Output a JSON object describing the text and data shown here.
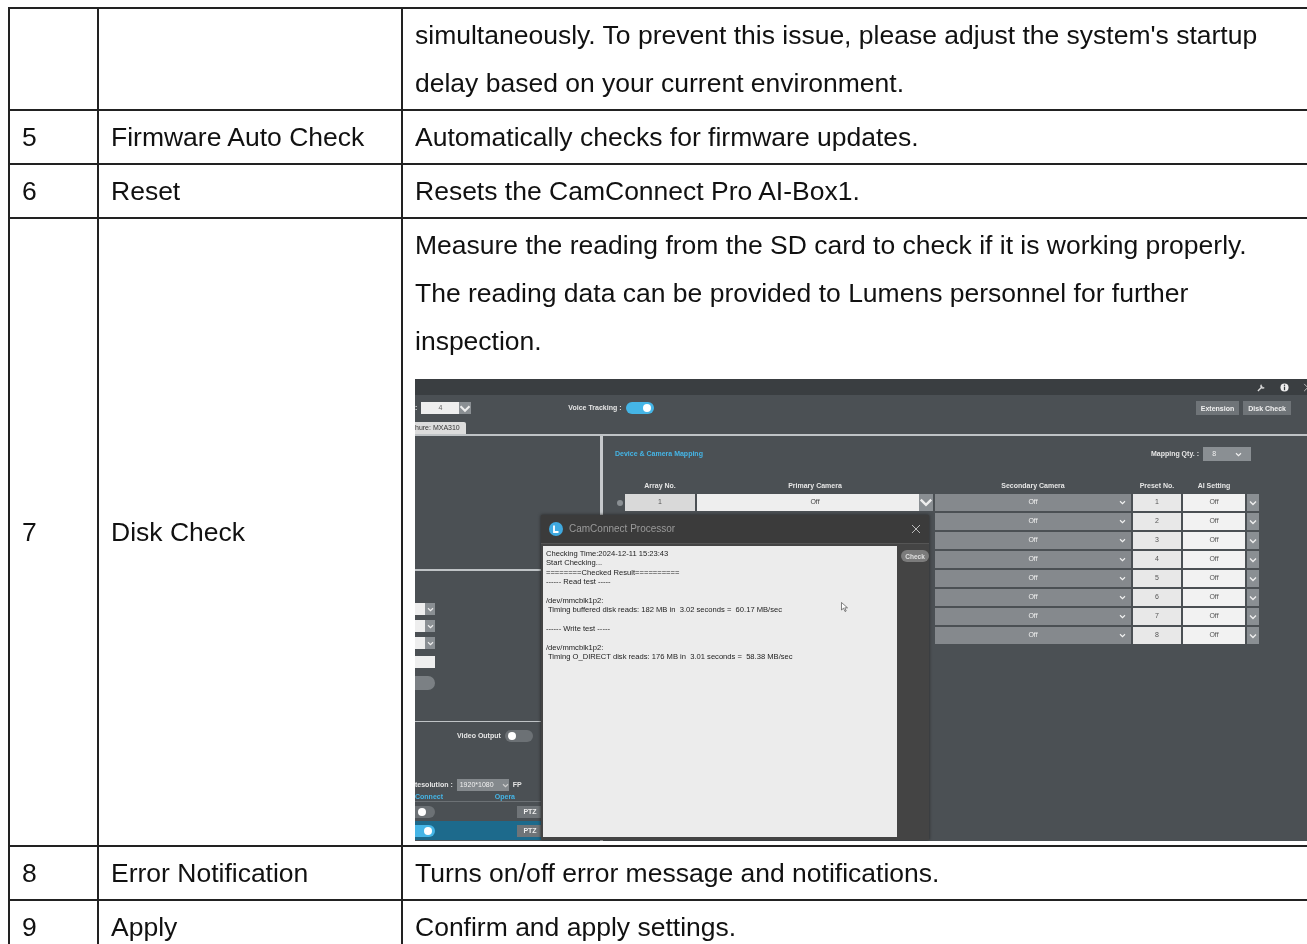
{
  "table": {
    "rows": [
      {
        "number": "",
        "item": "",
        "description": "simultaneously. To prevent this issue, please adjust the system's startup delay based on your current environment."
      },
      {
        "number": "5",
        "item": "Firmware Auto Check",
        "description": "Automatically checks for firmware updates."
      },
      {
        "number": "6",
        "item": "Reset",
        "description": "Resets the CamConnect Pro AI-Box1."
      },
      {
        "number": "7",
        "item": "Disk Check",
        "description": "Measure the reading from the SD card to check if it is working properly. The reading data can be provided to Lumens personnel for further inspection.",
        "screenshot": {
          "toolbar": {
            "count_label": ":",
            "count_value": "4",
            "voice_tracking_label": "Voice Tracking :",
            "voice_tracking_on": true,
            "buttons": [
              "Extension",
              "Disk Check"
            ]
          },
          "tab": "hure: MXA310",
          "mapping": {
            "title": "Device & Camera Mapping",
            "qty_label": "Mapping Qty. :",
            "qty_value": "8",
            "columns": [
              "Array No.",
              "Primary Camera",
              "Secondary Camera",
              "Preset No.",
              "AI Setting"
            ],
            "rows": [
              {
                "array": "1",
                "primary": "Off",
                "secondary": "Off",
                "preset": "1",
                "ai": "Off"
              },
              {
                "secondary": "Off",
                "preset": "2",
                "ai": "Off"
              },
              {
                "secondary": "Off",
                "preset": "3",
                "ai": "Off"
              },
              {
                "secondary": "Off",
                "preset": "4",
                "ai": "Off"
              },
              {
                "secondary": "Off",
                "preset": "5",
                "ai": "Off"
              },
              {
                "secondary": "Off",
                "preset": "6",
                "ai": "Off"
              },
              {
                "secondary": "Off",
                "preset": "7",
                "ai": "Off"
              },
              {
                "secondary": "Off",
                "preset": "8",
                "ai": "Off"
              }
            ]
          },
          "dialog": {
            "title": "CamConnect Processor",
            "check_button": "Check",
            "log": [
              {
                "text": "Checking Time:2024-12-11 15:23:43",
                "blank_before": false
              },
              {
                "text": "Start Checking...",
                "blank_before": false
              },
              {
                "text": "========Checked Result==========",
                "blank_before": false
              },
              {
                "text": "------ Read test -----",
                "blank_before": false
              },
              {
                "text": "/dev/mmcblk1p2:",
                "blank_before": true
              },
              {
                "text": " Timing buffered disk reads: 182 MB in  3.02 seconds =  60.17 MB/sec",
                "blank_before": false
              },
              {
                "text": "------ Write test -----",
                "blank_before": true
              },
              {
                "text": "/dev/mmcblk1p2:",
                "blank_before": true
              },
              {
                "text": " Timing O_DIRECT disk reads: 176 MB in  3.01 seconds =  58.38 MB/sec",
                "blank_before": false
              }
            ]
          },
          "left": {
            "video_output_label": "Video Output",
            "video_output_on": false,
            "resolution_label": "tesolution :",
            "resolution_value": "1920*1080",
            "fps_label": "FP",
            "columns": [
              "Connect",
              "Opera"
            ],
            "devices": [
              {
                "connected": false,
                "button": "PTZ",
                "selected": false
              },
              {
                "connected": true,
                "button": "PTZ",
                "selected": true
              }
            ]
          }
        }
      },
      {
        "number": "8",
        "item": "Error Notification",
        "description": "Turns on/off error message and notifications."
      },
      {
        "number": "9",
        "item": "Apply",
        "description": "Confirm and apply settings."
      }
    ]
  }
}
